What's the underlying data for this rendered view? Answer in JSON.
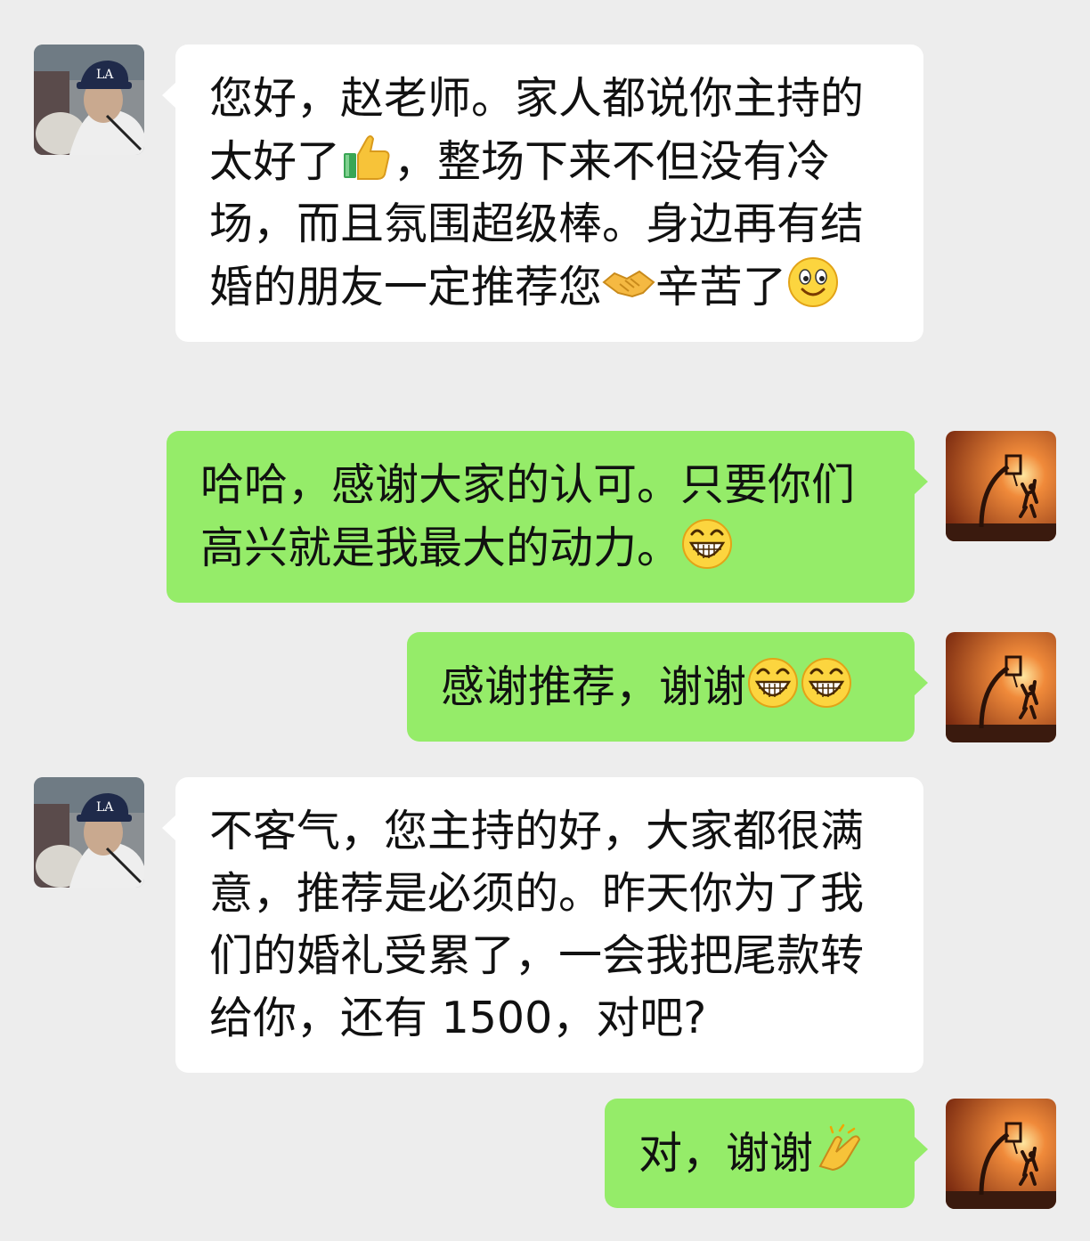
{
  "chat": {
    "messages": [
      {
        "sender": "other",
        "segments": [
          {
            "text": "您好，赵老师。家人都说你主持的太好了"
          },
          {
            "emoji": "thumbs-up"
          },
          {
            "text": "，整场下来不但没有冷场，而且氛围超级棒。身边再有结婚的朋友一定推荐您"
          },
          {
            "emoji": "handshake"
          },
          {
            "text": "辛苦了"
          },
          {
            "emoji": "smile"
          }
        ]
      },
      {
        "sender": "me",
        "segments": [
          {
            "text": "哈哈，感谢大家的认可。只要你们高兴就是我最大的动力。"
          },
          {
            "emoji": "grin"
          }
        ]
      },
      {
        "sender": "me",
        "segments": [
          {
            "text": "感谢推荐，谢谢"
          },
          {
            "emoji": "grin"
          },
          {
            "emoji": "grin"
          }
        ]
      },
      {
        "sender": "other",
        "segments": [
          {
            "text": "不客气，您主持的好，大家都很满意，推荐是必须的。昨天你为了我们的婚礼受累了，一会我把尾款转给你，还有 1500，对吧?"
          }
        ]
      },
      {
        "sender": "me",
        "segments": [
          {
            "text": "对，谢谢"
          },
          {
            "emoji": "clap"
          }
        ]
      }
    ]
  },
  "colors": {
    "background": "#ededed",
    "incoming_bubble": "#ffffff",
    "outgoing_bubble": "#95ec69",
    "text": "#111111"
  }
}
